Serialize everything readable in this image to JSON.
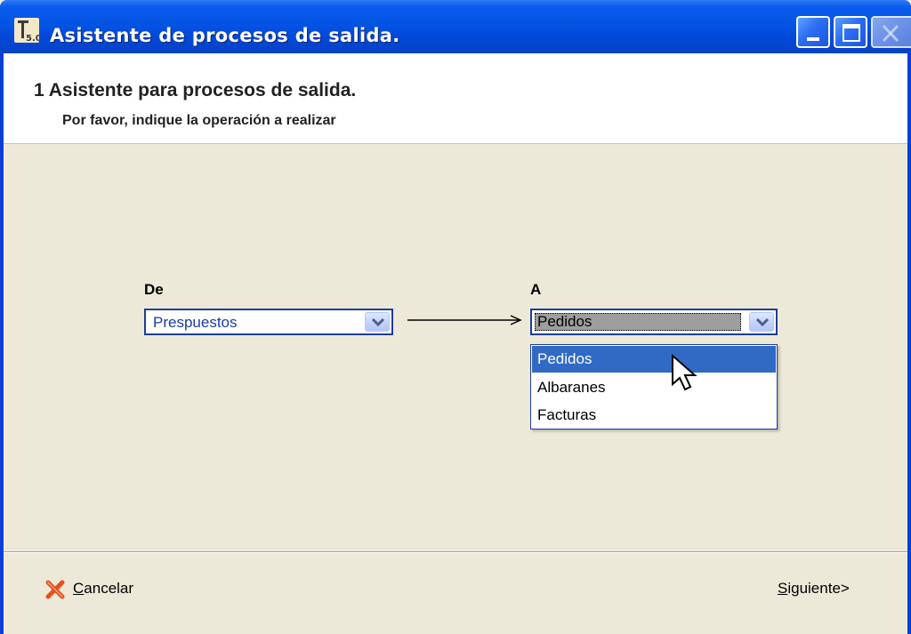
{
  "window": {
    "title": "Asistente de procesos de salida.",
    "app_icon": "app-logo-icon"
  },
  "header": {
    "step_number": "1",
    "title": "Asistente para procesos de salida.",
    "subtitle": "Por favor, indique la operación a realizar"
  },
  "form": {
    "from_label": "De",
    "from_value": "Prespuestos",
    "to_label": "A",
    "to_value": "Pedidos",
    "to_options": [
      "Pedidos",
      "Albaranes",
      "Facturas"
    ],
    "to_selected_index": 0
  },
  "footer": {
    "cancel_label_accel": "C",
    "cancel_label_rest": "ancelar",
    "next_label_accel": "S",
    "next_label_rest": "iguiente>"
  },
  "colors": {
    "titlebar": "#0454e3",
    "selection": "#316ac5",
    "combo_text": "#1a3aa8",
    "cancel_icon": "#e8501a"
  }
}
